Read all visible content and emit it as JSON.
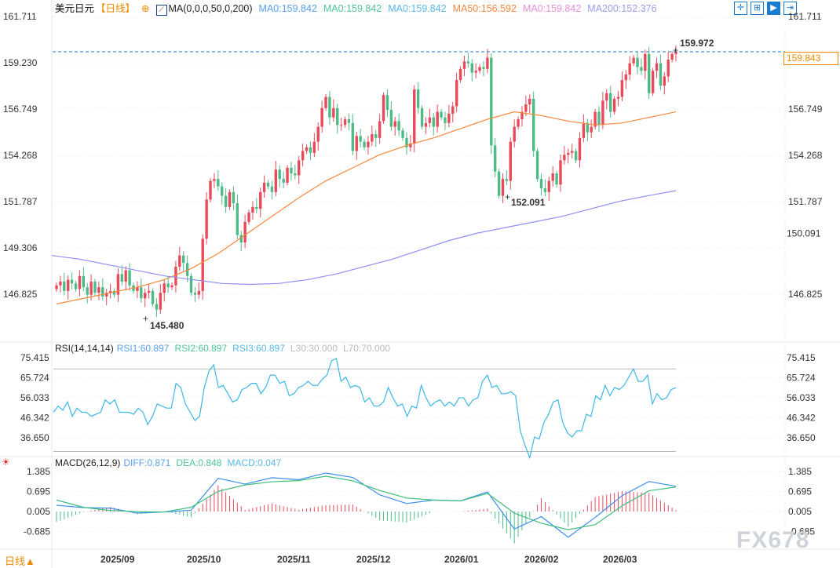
{
  "header": {
    "symbol": "美元日元",
    "period": "【日线】",
    "ma_label": "MA(0,0,0,50,0,200)",
    "ma_values": [
      {
        "text": "MA0:159.842",
        "color": "#5aa0f0"
      },
      {
        "text": "MA0:159.842",
        "color": "#4fc39a"
      },
      {
        "text": "MA0:159.842",
        "color": "#58b8e8"
      },
      {
        "text": "MA50:156.592",
        "color": "#f5883a"
      },
      {
        "text": "MA0:159.842",
        "color": "#e98fd8"
      },
      {
        "text": "MA200:152.376",
        "color": "#9a9cf0"
      }
    ]
  },
  "toolbar": {
    "icons": [
      "crosshair-icon",
      "range-icon",
      "play-icon",
      "exit-icon"
    ],
    "glyphs": [
      "✛",
      "⊞",
      "▶",
      "⇥"
    ]
  },
  "colors": {
    "up": "#e84a5a",
    "down": "#4dbb87",
    "ma50": "#f5883a",
    "ma200": "#8f8ff5",
    "rsi": "#3cb7e8",
    "diff": "#3a8ef0",
    "dea": "#3cbf7a",
    "price_line": "#1a7cd0",
    "current_price": "#f08a00"
  },
  "bottom_label": "日线▲",
  "watermark": "FX678",
  "chart_data": [
    {
      "type": "candlestick",
      "title": "美元日元 【日线】",
      "yticks": [
        "161.711",
        "159.230",
        "156.749",
        "154.268",
        "151.787",
        "149.306",
        "146.825"
      ],
      "right_yticks": [
        "161.711",
        "156.749",
        "154.268",
        "151.787",
        "146.825"
      ],
      "ylim": [
        145.2,
        161.711
      ],
      "xticks": [
        "2025/09",
        "2025/10",
        "2025/11",
        "2025/12",
        "2026/01",
        "2026/02",
        "2026/03"
      ],
      "current_price": "159.843",
      "ma200_marker": "150.091",
      "annotations": {
        "high": "159.972",
        "low1": "145.480",
        "low2": "152.091"
      },
      "closes": [
        147.3,
        147.5,
        147.0,
        147.6,
        147.4,
        147.1,
        147.8,
        147.2,
        146.8,
        147.5,
        146.9,
        147.2,
        146.7,
        146.9,
        147.0,
        146.8,
        147.9,
        147.5,
        148.1,
        147.3,
        147.0,
        147.2,
        146.6,
        146.9,
        147.0,
        146.3,
        146.0,
        146.9,
        147.4,
        147.2,
        147.3,
        148.3,
        148.9,
        148.5,
        147.8,
        146.9,
        146.8,
        147.0,
        149.8,
        151.9,
        152.9,
        153.0,
        152.6,
        152.1,
        151.5,
        152.3,
        151.7,
        150.0,
        149.6,
        150.7,
        151.2,
        151.5,
        151.4,
        152.3,
        152.8,
        152.6,
        152.3,
        153.5,
        153.0,
        152.8,
        153.6,
        153.3,
        153.2,
        154.0,
        154.5,
        154.7,
        154.4,
        155.0,
        155.8,
        156.8,
        157.4,
        156.3,
        156.8,
        155.9,
        155.9,
        156.2,
        156.0,
        154.5,
        155.3,
        155.0,
        154.7,
        155.0,
        155.4,
        155.2,
        156.1,
        157.5,
        156.7,
        155.8,
        156.1,
        155.6,
        155.2,
        154.7,
        154.9,
        157.8,
        156.8,
        155.8,
        156.0,
        156.3,
        155.8,
        156.6,
        156.3,
        156.0,
        156.5,
        156.9,
        158.3,
        158.9,
        159.3,
        159.2,
        158.7,
        158.8,
        159.0,
        158.9,
        159.5,
        154.8,
        153.4,
        152.1,
        153.0,
        152.9,
        155.0,
        155.8,
        156.2,
        156.6,
        157.0,
        157.3,
        154.5,
        153.0,
        152.5,
        152.3,
        152.9,
        153.3,
        152.7,
        154.0,
        154.3,
        154.4,
        154.5,
        154.0,
        155.2,
        156.0,
        155.5,
        155.8,
        156.6,
        155.9,
        157.2,
        157.6,
        156.6,
        157.3,
        157.4,
        158.3,
        158.6,
        159.2,
        159.5,
        159.0,
        158.8,
        159.7,
        157.6,
        158.8,
        159.2,
        158.0,
        158.5,
        159.4,
        159.7,
        159.843
      ],
      "series": [
        {
          "name": "MA50",
          "values": [
            146.3,
            146.6,
            146.9,
            147.2,
            147.6,
            148.2,
            149.0,
            150.0,
            151.0,
            152.0,
            152.9,
            153.6,
            154.3,
            154.8,
            155.2,
            155.7,
            156.2,
            156.6,
            156.4,
            156.1,
            155.9,
            156.0,
            156.3,
            156.6
          ]
        },
        {
          "name": "MA200",
          "values": [
            148.9,
            148.7,
            148.4,
            148.1,
            147.8,
            147.6,
            147.4,
            147.35,
            147.4,
            147.6,
            147.9,
            148.3,
            148.7,
            149.2,
            149.7,
            150.1,
            150.4,
            150.7,
            151.0,
            151.4,
            151.8,
            152.1,
            152.376
          ]
        }
      ]
    },
    {
      "type": "line",
      "title": "RSI(14,14,14)",
      "legend": [
        {
          "text": "RSI1:60.897",
          "color": "#5aa0f0"
        },
        {
          "text": "RSI2:60.897",
          "color": "#4fc39a"
        },
        {
          "text": "RSI3:60.897",
          "color": "#58b8e8"
        },
        {
          "text": "L30:30.000",
          "color": "#bbbbbb"
        },
        {
          "text": "L70:70.000",
          "color": "#bbbbbb"
        }
      ],
      "yticks": [
        "75.415",
        "65.724",
        "56.033",
        "46.342",
        "36.650"
      ],
      "ylim": [
        27,
        80
      ],
      "levels": [
        30,
        70
      ],
      "values": [
        49,
        52,
        50,
        54,
        47,
        51,
        49,
        49,
        47,
        48,
        49,
        55,
        53,
        55,
        49,
        49,
        49,
        48,
        51,
        49,
        43,
        47,
        53,
        52,
        51,
        51,
        63,
        61,
        53,
        49,
        45,
        47,
        61,
        69,
        72,
        61,
        62,
        58,
        54,
        55,
        60,
        61,
        63,
        63,
        58,
        61,
        67,
        67,
        63,
        64,
        57,
        58,
        61,
        62,
        64,
        62,
        62,
        65,
        67,
        74,
        75,
        64,
        66,
        61,
        62,
        61,
        54,
        56,
        52,
        52,
        54,
        61,
        56,
        52,
        53,
        47,
        52,
        51,
        62,
        56,
        52,
        54,
        55,
        52,
        54,
        52,
        56,
        56,
        52,
        55,
        56,
        64,
        67,
        61,
        62,
        58,
        58,
        59,
        57,
        40,
        33,
        27,
        37,
        36,
        44,
        48,
        54,
        55,
        44,
        39,
        37,
        40,
        40,
        48,
        47,
        57,
        55,
        62,
        57,
        61,
        60,
        62,
        66,
        70,
        64,
        64,
        67,
        53,
        58,
        55,
        56,
        60,
        60.897
      ]
    },
    {
      "type": "line",
      "title": "MACD(26,12,9)",
      "legend": [
        {
          "text": "DIFF:0.871",
          "color": "#5aa0f0"
        },
        {
          "text": "DEA:0.848",
          "color": "#4fc39a"
        },
        {
          "text": "MACD:0.047",
          "color": "#58b8e8"
        }
      ],
      "yticks": [
        "1.385",
        "0.695",
        "0.005",
        "-0.685"
      ],
      "ylim": [
        -1.3,
        1.6
      ],
      "series": [
        {
          "name": "DIFF",
          "values": [
            0.22,
            0.14,
            0.12,
            -0.05,
            -0.01,
            0.05,
            1.15,
            0.95,
            1.17,
            1.1,
            1.33,
            1.18,
            0.58,
            0.28,
            0.4,
            0.37,
            0.68,
            -0.6,
            -0.17,
            -0.88,
            -0.2,
            0.55,
            1.04,
            0.871
          ]
        },
        {
          "name": "DEA",
          "values": [
            0.4,
            0.15,
            0.04,
            0.0,
            -0.01,
            0.15,
            0.7,
            0.92,
            1.03,
            1.07,
            1.22,
            1.06,
            0.73,
            0.47,
            0.4,
            0.37,
            0.63,
            -0.05,
            -0.4,
            -0.62,
            -0.45,
            0.2,
            0.72,
            0.848
          ]
        }
      ]
    }
  ]
}
